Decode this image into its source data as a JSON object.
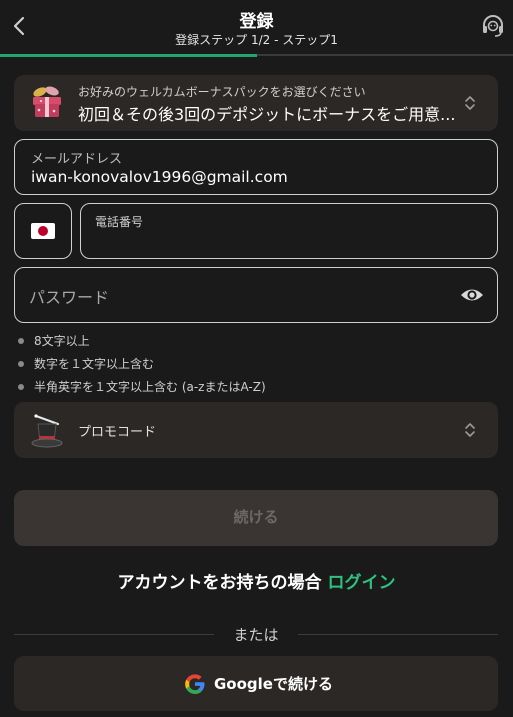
{
  "header": {
    "title": "登録",
    "step": "登録ステップ 1/2 - ステップ1",
    "progress": 0.5
  },
  "bonus": {
    "subtitle": "お好みのウェルカムボーナスパックをお選びください",
    "selected": "初回＆その後3回のデポジットにボーナスをご用意..."
  },
  "email": {
    "label": "メールアドレス",
    "value": "iwan-konovalov1996@gmail.com"
  },
  "phone": {
    "country_flag": "japan-flag",
    "label": "電話番号"
  },
  "password": {
    "placeholder": "パスワード"
  },
  "requirements": [
    "8文字以上",
    "数字を１文字以上含む",
    "半角英字を１文字以上含む (a-zまたはA-Z)"
  ],
  "promo": {
    "label": "プロモコード"
  },
  "continue_label": "続ける",
  "login": {
    "prompt": "アカウントをお持ちの場合 ",
    "link": "ログイン"
  },
  "or_label": "または",
  "google_label": "Googleで続ける",
  "colors": {
    "accent": "#23a36e",
    "link": "#2ec27e",
    "background": "#1a1a1a",
    "panel": "#2b2825"
  }
}
